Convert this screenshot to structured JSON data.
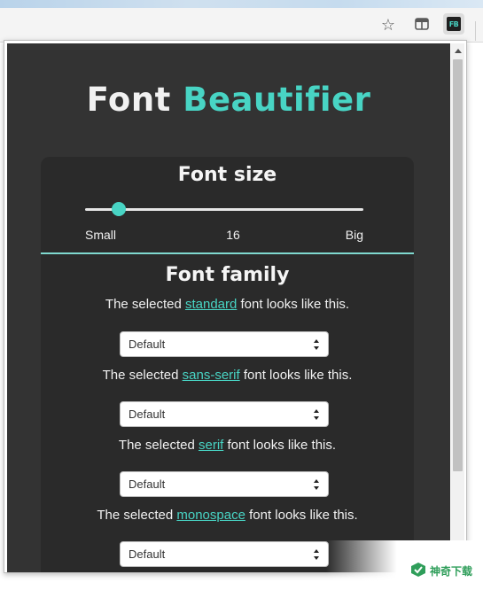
{
  "browser": {
    "extension_badge": "FB",
    "icons": [
      "star-icon",
      "extension-icon",
      "font-beautifier-extension-icon"
    ]
  },
  "app": {
    "title_part1": "Font",
    "title_part2": "Beautifier",
    "accent_color": "#48d4c4",
    "background_color": "#333333"
  },
  "font_size": {
    "heading": "Font size",
    "min_label": "Small",
    "value": "16",
    "max_label": "Big",
    "slider_fraction": 0.12
  },
  "font_family": {
    "heading": "Font family",
    "rows": [
      {
        "prefix": "The selected ",
        "link": "standard",
        "suffix": " font looks like this.",
        "select_value": "Default"
      },
      {
        "prefix": "The selected ",
        "link": "sans-serif",
        "suffix": " font looks like this.",
        "select_value": "Default"
      },
      {
        "prefix": "The selected ",
        "link": "serif",
        "suffix": " font looks like this.",
        "select_value": "Default"
      },
      {
        "prefix": "The selected ",
        "link": "monospace",
        "suffix": " font looks like this.",
        "select_value": "Default"
      }
    ]
  },
  "watermark": {
    "text": "神奇下载"
  }
}
